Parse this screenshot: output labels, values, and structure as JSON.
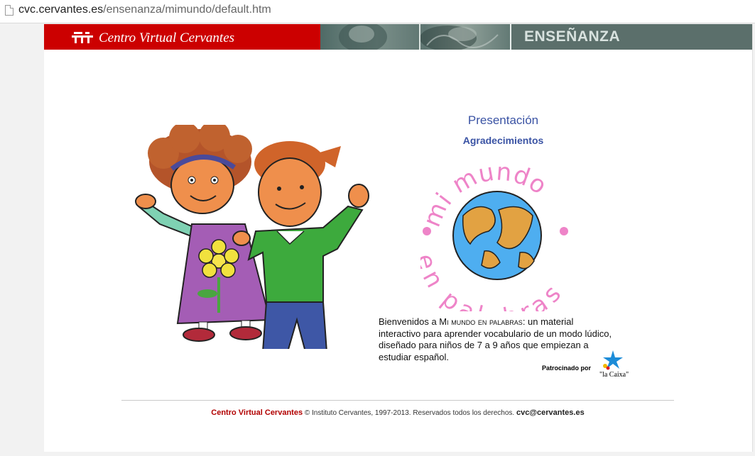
{
  "browser": {
    "url_host": "cvc.cervantes.es",
    "url_path": "/ensenanza/mimundo/default.htm"
  },
  "header": {
    "brand": "Centro Virtual Cervantes",
    "section": "ENSEÑANZA"
  },
  "nav": {
    "presentacion": "Presentación",
    "agradecimientos": "Agradecimientos"
  },
  "logo": {
    "line1": "mi mundo",
    "line2": "en palabras"
  },
  "welcome": {
    "pre": "Bienvenidos a ",
    "title": "Mi mundo en palabras",
    "post": ": un material interactivo para aprender vocabulario de un modo lúdico, diseñado para niños de 7 a 9 años que empiezan a estudiar español."
  },
  "sponsor": {
    "label": "Patrocinado por",
    "name": "\"la Caixa\""
  },
  "footer": {
    "brand": "Centro Virtual Cervantes",
    "copyright": " © Instituto Cervantes, 1997-2013. Reservados todos los derechos. ",
    "email": "cvc@cervantes.es"
  },
  "colors": {
    "banner_red": "#cc0000",
    "banner_teal": "#5b6f6b",
    "link_blue": "#3a53a4",
    "logo_pink": "#ee84c8",
    "footer_red": "#b20000"
  }
}
